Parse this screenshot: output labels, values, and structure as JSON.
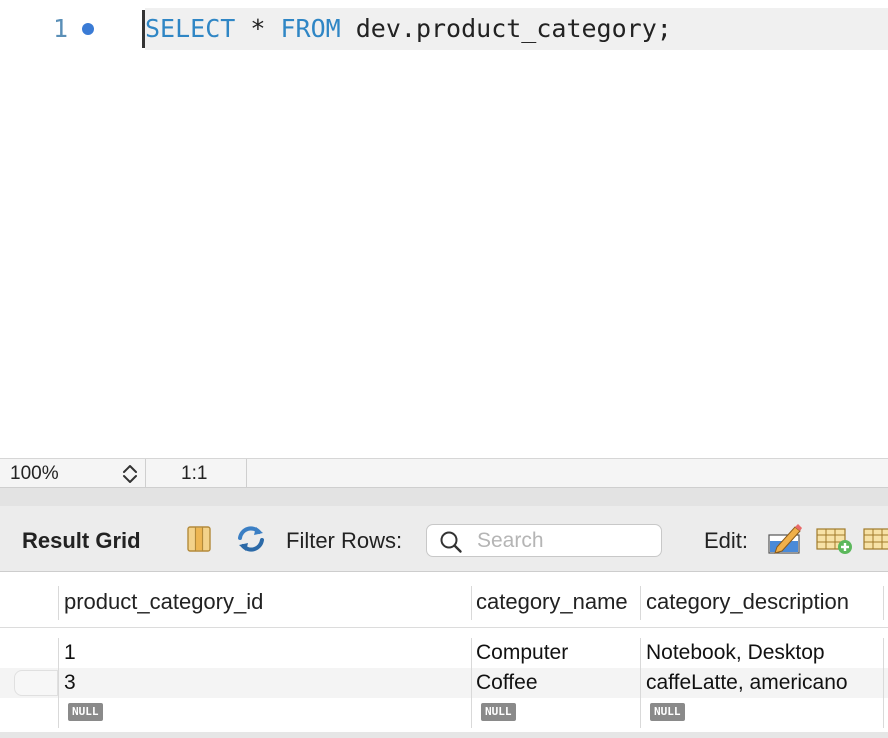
{
  "editor": {
    "line_number": "1",
    "code": {
      "kw1": "SELECT",
      "op": " * ",
      "kw2": "FROM",
      "rest": " dev.product_category;"
    }
  },
  "status_bar": {
    "zoom": "100%",
    "cursor_position": "1:1"
  },
  "result_toolbar": {
    "title": "Result Grid",
    "filter_label": "Filter Rows:",
    "search_placeholder": "Search",
    "search_value": "",
    "edit_label": "Edit:",
    "icons": [
      "column-toggle-icon",
      "refresh-icon",
      "search-icon",
      "edit-pencil-icon",
      "add-row-icon",
      "delete-row-icon"
    ]
  },
  "grid": {
    "columns": [
      "product_category_id",
      "category_name",
      "category_description"
    ],
    "rows": [
      [
        "1",
        "Computer",
        "Notebook, Desktop"
      ],
      [
        "3",
        "Coffee",
        "caffeLatte, americano"
      ],
      [
        "NULL",
        "NULL",
        "NULL"
      ]
    ]
  },
  "colors": {
    "keyword": "#2f86c5",
    "line_number": "#5a8fb7",
    "exec_dot": "#3a7bd5",
    "null_badge": "#8a8a8a"
  }
}
